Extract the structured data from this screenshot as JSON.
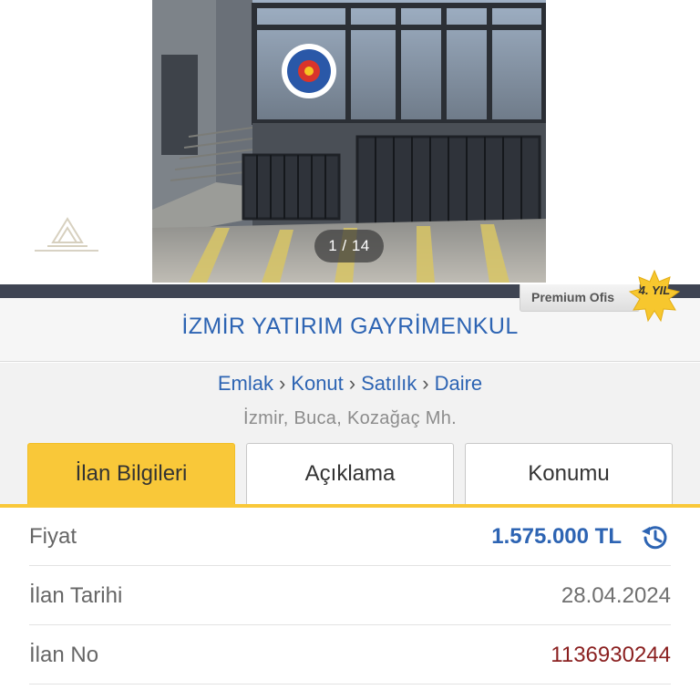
{
  "gallery": {
    "counter": "1 / 14"
  },
  "store": {
    "name": "İZMİR YATIRIM GAYRİMENKUL",
    "badge": "Premium Ofis",
    "year_badge": "4. YIL"
  },
  "breadcrumb": [
    "Emlak",
    "Konut",
    "Satılık",
    "Daire"
  ],
  "location": "İzmir, Buca, Kozağaç Mh.",
  "tabs": [
    {
      "label": "İlan Bilgileri",
      "active": true
    },
    {
      "label": "Açıklama",
      "active": false
    },
    {
      "label": "Konumu",
      "active": false
    }
  ],
  "details": {
    "price_label": "Fiyat",
    "price_value": "1.575.000 TL",
    "date_label": "İlan Tarihi",
    "date_value": "28.04.2024",
    "listing_label": "İlan No",
    "listing_value": "1136930244"
  },
  "colors": {
    "accent_blue": "#2d64b3",
    "tab_active": "#f9c839",
    "listing_no": "#8a1f1f",
    "dark_bar": "#3f4553"
  },
  "icons": {
    "price_history": "history-clock-icon",
    "year_badge": "star-badge-icon"
  }
}
